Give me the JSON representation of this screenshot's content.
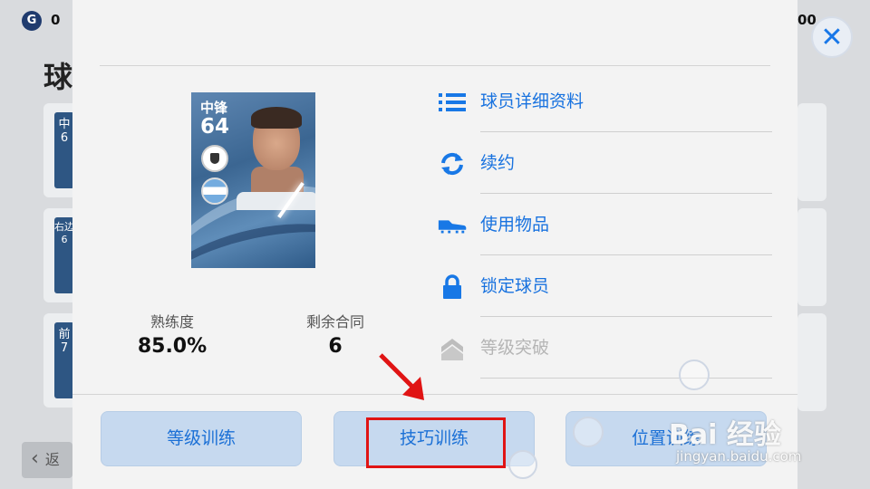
{
  "top_bar": {
    "coin_icon_letter": "G",
    "coin_count": "0",
    "right_count_partial": "00"
  },
  "background": {
    "title_partial": "球",
    "card_labels": [
      "中",
      "右边",
      "前"
    ],
    "card_ratings": [
      "6",
      "6",
      "7"
    ],
    "back_label_partial": "返"
  },
  "close_button": {
    "glyph": "✕"
  },
  "modal": {
    "title": "",
    "player_card": {
      "position": "中锋",
      "rating": "64"
    },
    "stats": [
      {
        "label": "熟练度",
        "value": "85.0%"
      },
      {
        "label": "剩余合同",
        "value": "6"
      }
    ],
    "menu": [
      {
        "icon": "list-icon",
        "label": "球员详细资料",
        "enabled": true
      },
      {
        "icon": "refresh-icon",
        "label": "续约",
        "enabled": true
      },
      {
        "icon": "boot-icon",
        "label": "使用物品",
        "enabled": true
      },
      {
        "icon": "lock-icon",
        "label": "锁定球员",
        "enabled": true
      },
      {
        "icon": "rank-up-icon",
        "label": "等级突破",
        "enabled": false
      }
    ],
    "bottom_buttons": [
      {
        "label": "等级训练"
      },
      {
        "label": "技巧训练"
      },
      {
        "label": "位置训练"
      }
    ]
  },
  "watermark": {
    "brand": "Bai 经验",
    "url": "jingyan.baidu.com"
  },
  "colors": {
    "accent": "#1872df",
    "disabled": "#b5b5b5",
    "button_bg": "#c6d9ef",
    "highlight": "#e01414"
  }
}
